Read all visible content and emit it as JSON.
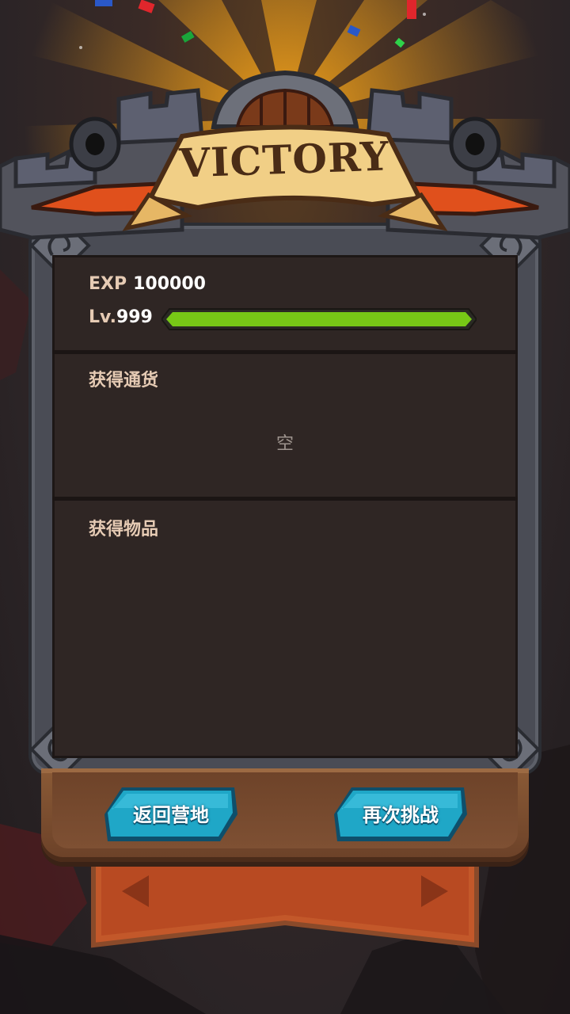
{
  "header": {
    "title": "VICTORY"
  },
  "exp": {
    "label": "EXP",
    "value": "100000"
  },
  "level": {
    "prefix": "Lv.",
    "value": "999",
    "progress": 1.0
  },
  "currency": {
    "title": "获得通货",
    "empty_text": "空"
  },
  "items": {
    "title": "获得物品"
  },
  "buttons": {
    "return_label": "返回营地",
    "retry_label": "再次挑战"
  },
  "colors": {
    "xp_bar": "#77c816",
    "button": "#1fa7c7",
    "panel": "#2f2624",
    "frame": "#4a4c55"
  }
}
